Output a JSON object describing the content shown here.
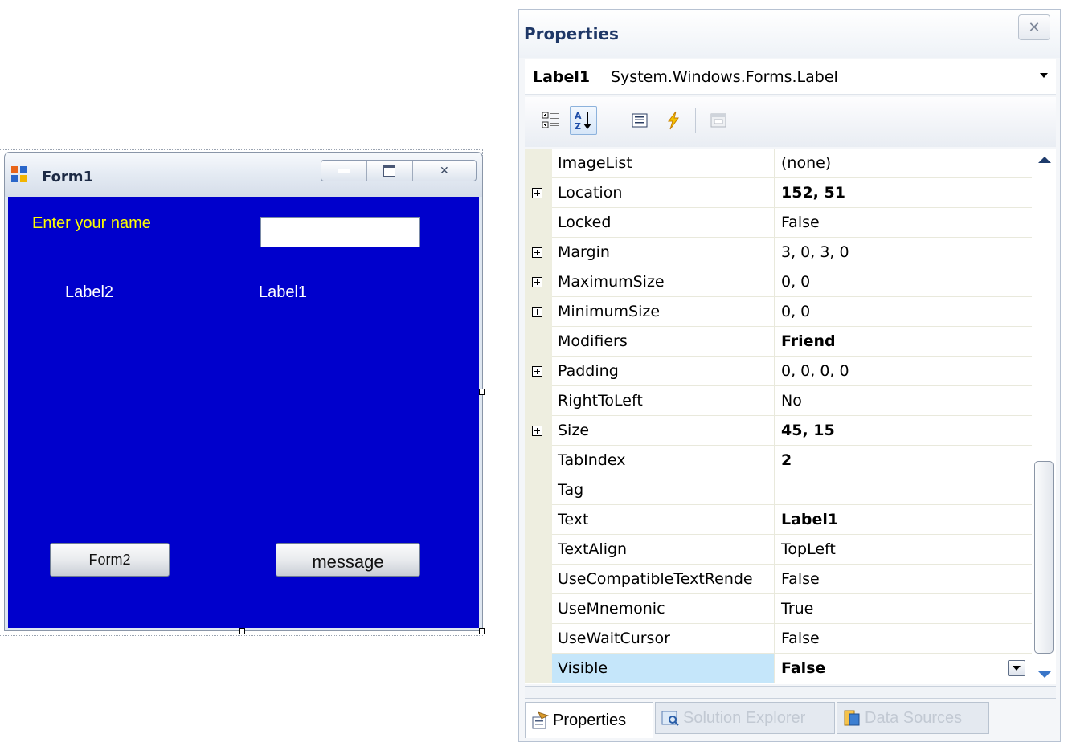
{
  "form": {
    "title": "Form1",
    "label_prompt": "Enter your name",
    "textbox_value": "",
    "label2": "Label2",
    "label1": "Label1",
    "button_form2": "Form2",
    "button_message": "message",
    "client_color": "#0000cc",
    "prompt_color": "#ffff00"
  },
  "properties_panel": {
    "title": "Properties",
    "close_glyph": "✕",
    "object_name": "Label1",
    "object_type": "System.Windows.Forms.Label",
    "toolbar": [
      "categorized-icon",
      "alphabetical-icon",
      "properties-icon",
      "events-icon",
      "property-pages-icon"
    ],
    "rows": [
      {
        "name": "ImageList",
        "value": "(none)",
        "bold": false,
        "expandable": false
      },
      {
        "name": "Location",
        "value": "152, 51",
        "bold": true,
        "expandable": true
      },
      {
        "name": "Locked",
        "value": "False",
        "bold": false,
        "expandable": false
      },
      {
        "name": "Margin",
        "value": "3, 0, 3, 0",
        "bold": false,
        "expandable": true
      },
      {
        "name": "MaximumSize",
        "value": "0, 0",
        "bold": false,
        "expandable": true
      },
      {
        "name": "MinimumSize",
        "value": "0, 0",
        "bold": false,
        "expandable": true
      },
      {
        "name": "Modifiers",
        "value": "Friend",
        "bold": true,
        "expandable": false
      },
      {
        "name": "Padding",
        "value": "0, 0, 0, 0",
        "bold": false,
        "expandable": true
      },
      {
        "name": "RightToLeft",
        "value": "No",
        "bold": false,
        "expandable": false
      },
      {
        "name": "Size",
        "value": "45, 15",
        "bold": true,
        "expandable": true
      },
      {
        "name": "TabIndex",
        "value": "2",
        "bold": true,
        "expandable": false
      },
      {
        "name": "Tag",
        "value": "",
        "bold": false,
        "expandable": false
      },
      {
        "name": "Text",
        "value": "Label1",
        "bold": true,
        "expandable": false
      },
      {
        "name": "TextAlign",
        "value": "TopLeft",
        "bold": false,
        "expandable": false
      },
      {
        "name": "UseCompatibleTextRende",
        "value": "False",
        "bold": false,
        "expandable": false
      },
      {
        "name": "UseMnemonic",
        "value": "True",
        "bold": false,
        "expandable": false
      },
      {
        "name": "UseWaitCursor",
        "value": "False",
        "bold": false,
        "expandable": false
      },
      {
        "name": "Visible",
        "value": "False",
        "bold": true,
        "expandable": false,
        "selected": true
      }
    ],
    "tabs": [
      {
        "label": "Properties",
        "active": true
      },
      {
        "label": "Solution Explorer",
        "active": false
      },
      {
        "label": "Data Sources",
        "active": false
      }
    ]
  }
}
